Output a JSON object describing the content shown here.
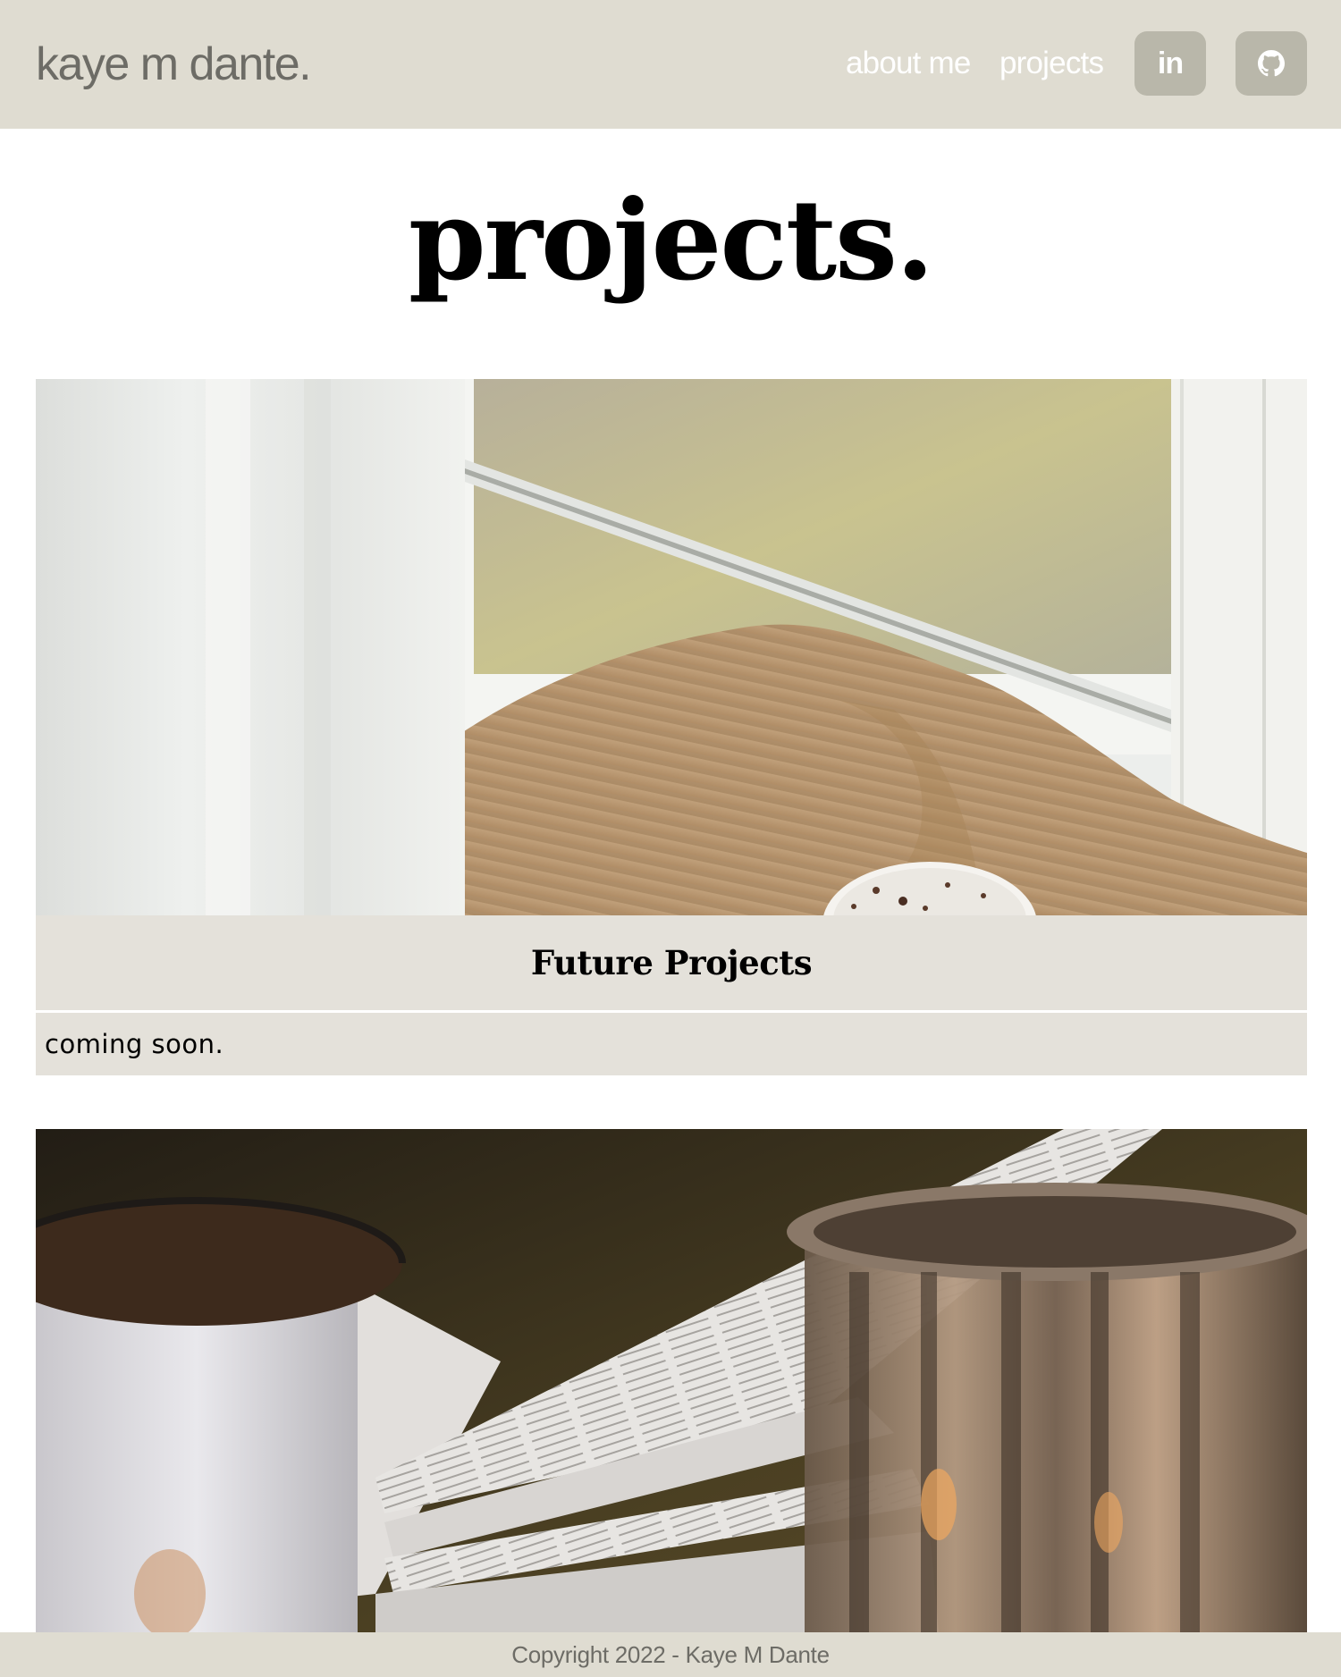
{
  "header": {
    "logo": "kaye m dante.",
    "nav": {
      "about": "about me",
      "projects": "projects"
    },
    "social": {
      "linkedin_label": "in",
      "linkedin_icon": "linkedin-icon",
      "github_icon": "github-icon"
    }
  },
  "main": {
    "title": "projects.",
    "cards": [
      {
        "image": "cozy-sweater-window-photo",
        "title": "Future Projects",
        "description": "coming soon."
      },
      {
        "image": "book-mug-candle-photo"
      }
    ]
  },
  "footer": {
    "copyright": "Copyright 2022 - Kaye M Dante"
  },
  "colors": {
    "header_bg": "#dfdcd1",
    "card_bg": "#e4e1da",
    "button_bg": "#b9b7aa",
    "logo_text": "#6d6c66"
  }
}
